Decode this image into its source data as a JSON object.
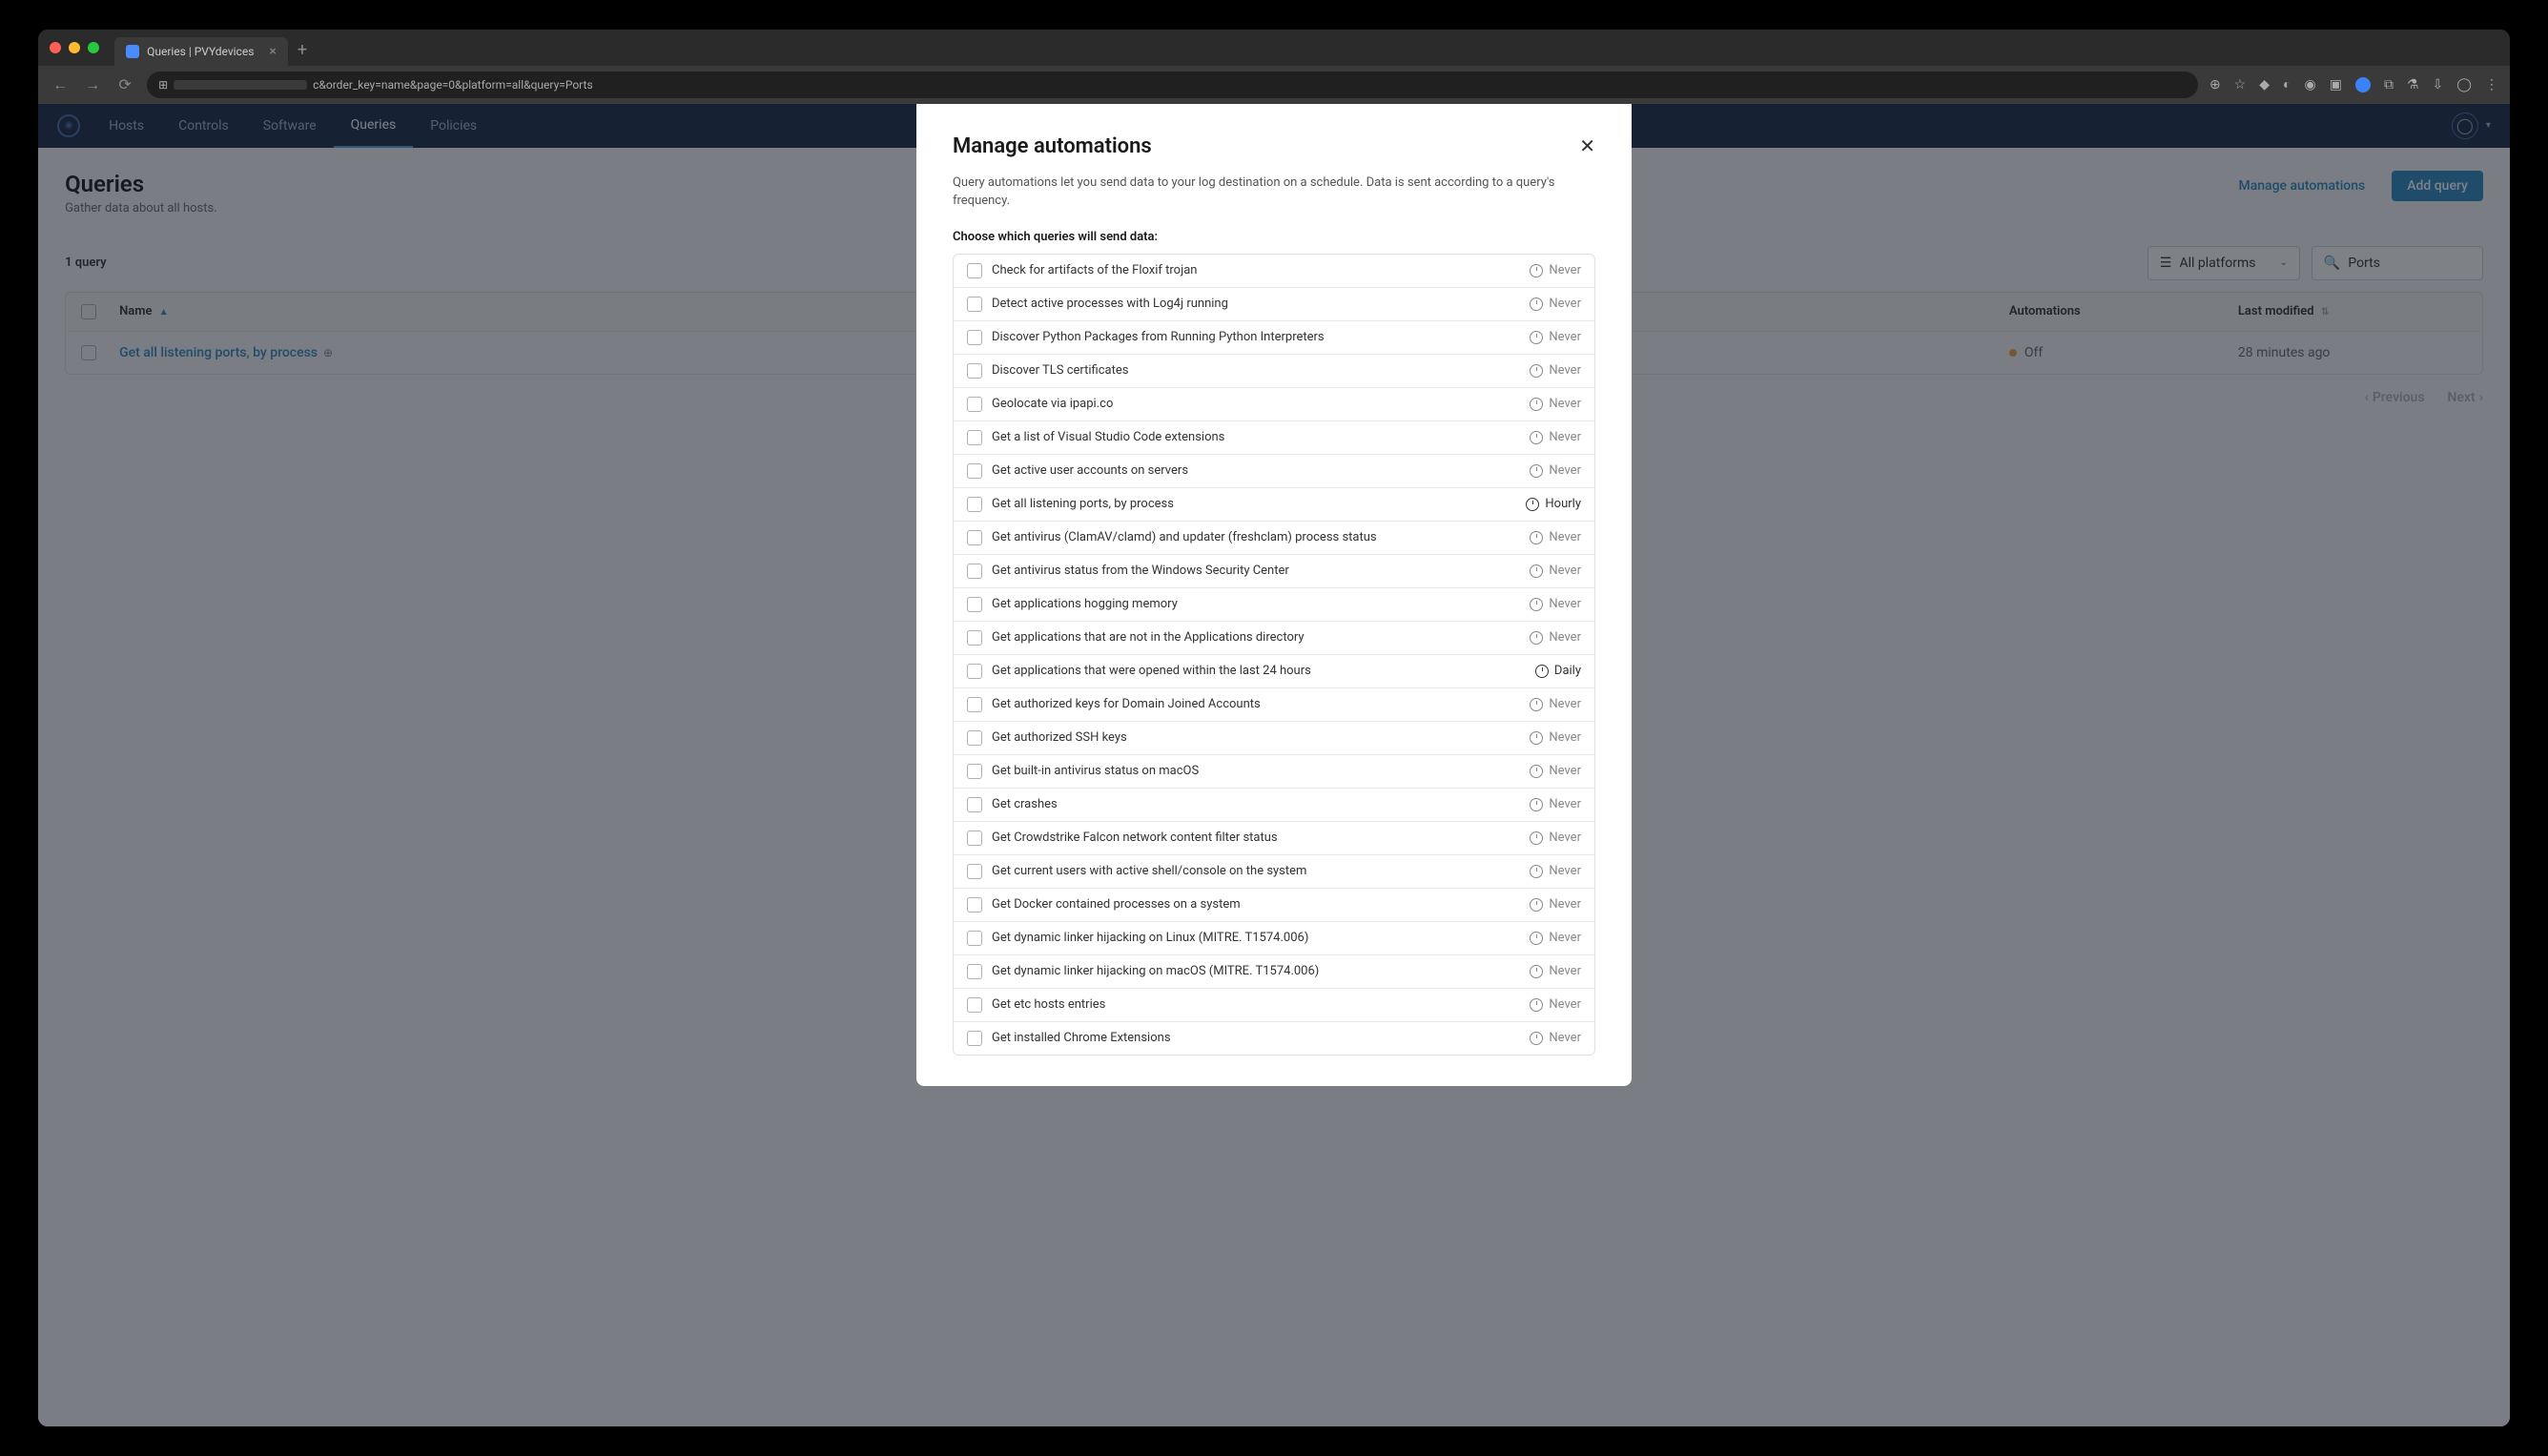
{
  "browser": {
    "tab_title": "Queries | PVYdevices",
    "url_suffix": "c&order_key=name&page=0&platform=all&query=Ports"
  },
  "nav": {
    "items": [
      "Hosts",
      "Controls",
      "Software",
      "Queries",
      "Policies"
    ],
    "active_index": 3
  },
  "page": {
    "title": "Queries",
    "subtitle": "Gather data about all hosts.",
    "count_label": "1 query",
    "manage_automations_label": "Manage automations",
    "add_query_label": "Add query",
    "platform_filter": "All platforms",
    "search_value": "Ports"
  },
  "table": {
    "headers": {
      "name": "Name",
      "automations": "Automations",
      "last_modified": "Last modified"
    },
    "rows": [
      {
        "name": "Get all listening ports, by process",
        "automation": "Off",
        "modified": "28 minutes ago"
      }
    ]
  },
  "pagination": {
    "prev": "Previous",
    "next": "Next"
  },
  "modal": {
    "title": "Manage automations",
    "description": "Query automations let you send data to your log destination on a schedule. Data is sent according to a query's frequency.",
    "section_label": "Choose which queries will send data:",
    "queries": [
      {
        "name": "Check for artifacts of the Floxif trojan",
        "freq": "Never"
      },
      {
        "name": "Detect active processes with Log4j running",
        "freq": "Never"
      },
      {
        "name": "Discover Python Packages from Running Python Interpreters",
        "freq": "Never"
      },
      {
        "name": "Discover TLS certificates",
        "freq": "Never"
      },
      {
        "name": "Geolocate via ipapi.co",
        "freq": "Never"
      },
      {
        "name": "Get a list of Visual Studio Code extensions",
        "freq": "Never"
      },
      {
        "name": "Get active user accounts on servers",
        "freq": "Never"
      },
      {
        "name": "Get all listening ports, by process",
        "freq": "Hourly"
      },
      {
        "name": "Get antivirus (ClamAV/clamd) and updater (freshclam) process status",
        "freq": "Never"
      },
      {
        "name": "Get antivirus status from the Windows Security Center",
        "freq": "Never"
      },
      {
        "name": "Get applications hogging memory",
        "freq": "Never"
      },
      {
        "name": "Get applications that are not in the Applications directory",
        "freq": "Never"
      },
      {
        "name": "Get applications that were opened within the last 24 hours",
        "freq": "Daily"
      },
      {
        "name": "Get authorized keys for Domain Joined Accounts",
        "freq": "Never"
      },
      {
        "name": "Get authorized SSH keys",
        "freq": "Never"
      },
      {
        "name": "Get built-in antivirus status on macOS",
        "freq": "Never"
      },
      {
        "name": "Get crashes",
        "freq": "Never"
      },
      {
        "name": "Get Crowdstrike Falcon network content filter status",
        "freq": "Never"
      },
      {
        "name": "Get current users with active shell/console on the system",
        "freq": "Never"
      },
      {
        "name": "Get Docker contained processes on a system",
        "freq": "Never"
      },
      {
        "name": "Get dynamic linker hijacking on Linux (MITRE. T1574.006)",
        "freq": "Never"
      },
      {
        "name": "Get dynamic linker hijacking on macOS (MITRE. T1574.006)",
        "freq": "Never"
      },
      {
        "name": "Get etc hosts entries",
        "freq": "Never"
      },
      {
        "name": "Get installed Chrome Extensions",
        "freq": "Never"
      }
    ]
  }
}
